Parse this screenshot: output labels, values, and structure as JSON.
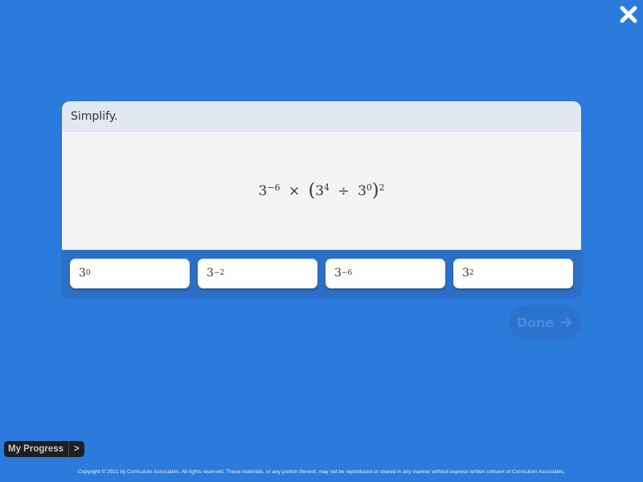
{
  "close": {
    "icon": "close-icon"
  },
  "question": {
    "prompt": "Simplify.",
    "expression": {
      "term1_base": "3",
      "term1_exp": "−6",
      "times": "×",
      "open_paren": "(",
      "term2_base": "3",
      "term2_exp": "4",
      "divide": "÷",
      "term3_base": "3",
      "term3_exp": "0",
      "close_paren": ")",
      "outer_exp": "2"
    }
  },
  "answers": [
    {
      "base": "3",
      "exp": "0"
    },
    {
      "base": "3",
      "exp": "−2"
    },
    {
      "base": "3",
      "exp": "−6"
    },
    {
      "base": "3",
      "exp": "2"
    }
  ],
  "done": {
    "label": "Done",
    "icon": "arrow-right-icon",
    "state": "disabled"
  },
  "progress": {
    "label": "My Progress",
    "chevron": ">"
  },
  "footer": {
    "copyright": "Copyright © 2021 by Curriculum Associates. All rights reserved. These materials, or any portion thereof, may not be reproduced or shared in any manner without express written consent of Curriculum Associates."
  }
}
